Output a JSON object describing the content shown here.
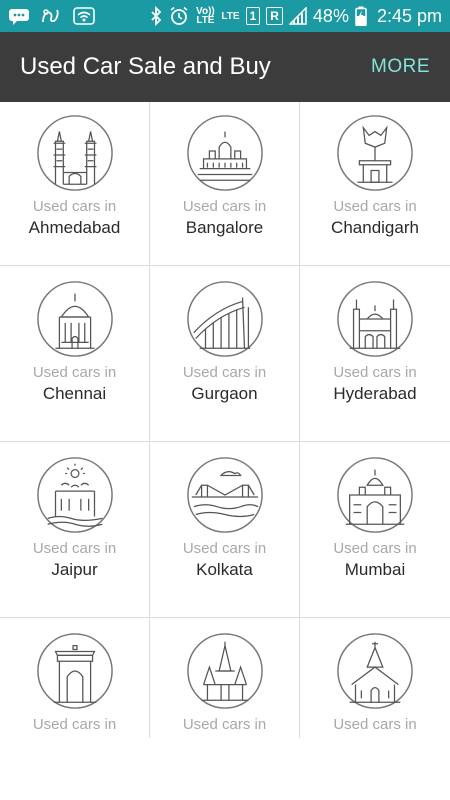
{
  "status_bar": {
    "left_icons": [
      "message-icon",
      "gesture-icon",
      "wifi-icon"
    ],
    "volte": "Vo)) LTE",
    "lte": "LTE",
    "sim": "1",
    "roaming": "R",
    "battery": "48%",
    "time": "2:45 pm",
    "color": "#1b9aa3"
  },
  "app_bar": {
    "title": "Used Car Sale and Buy",
    "more": "MORE",
    "background": "#3c3c3c",
    "accent": "#80e3dd"
  },
  "cities": [
    {
      "prefix": "Used cars in",
      "name": "Ahmedabad",
      "icon": "ahmedabad-landmark-icon"
    },
    {
      "prefix": "Used cars in",
      "name": "Bangalore",
      "icon": "bangalore-landmark-icon"
    },
    {
      "prefix": "Used cars in",
      "name": "Chandigarh",
      "icon": "chandigarh-landmark-icon"
    },
    {
      "prefix": "Used cars in",
      "name": "Chennai",
      "icon": "chennai-landmark-icon"
    },
    {
      "prefix": "Used cars in",
      "name": "Gurgaon",
      "icon": "gurgaon-landmark-icon"
    },
    {
      "prefix": "Used cars in",
      "name": "Hyderabad",
      "icon": "hyderabad-landmark-icon"
    },
    {
      "prefix": "Used cars in",
      "name": "Jaipur",
      "icon": "jaipur-landmark-icon"
    },
    {
      "prefix": "Used cars in",
      "name": "Kolkata",
      "icon": "kolkata-landmark-icon"
    },
    {
      "prefix": "Used cars in",
      "name": "Mumbai",
      "icon": "mumbai-landmark-icon"
    },
    {
      "prefix": "Used cars in",
      "name": "",
      "icon": "delhi-landmark-icon"
    },
    {
      "prefix": "Used cars in",
      "name": "",
      "icon": "temple-landmark-icon"
    },
    {
      "prefix": "Used cars in",
      "name": "",
      "icon": "church-landmark-icon"
    }
  ]
}
